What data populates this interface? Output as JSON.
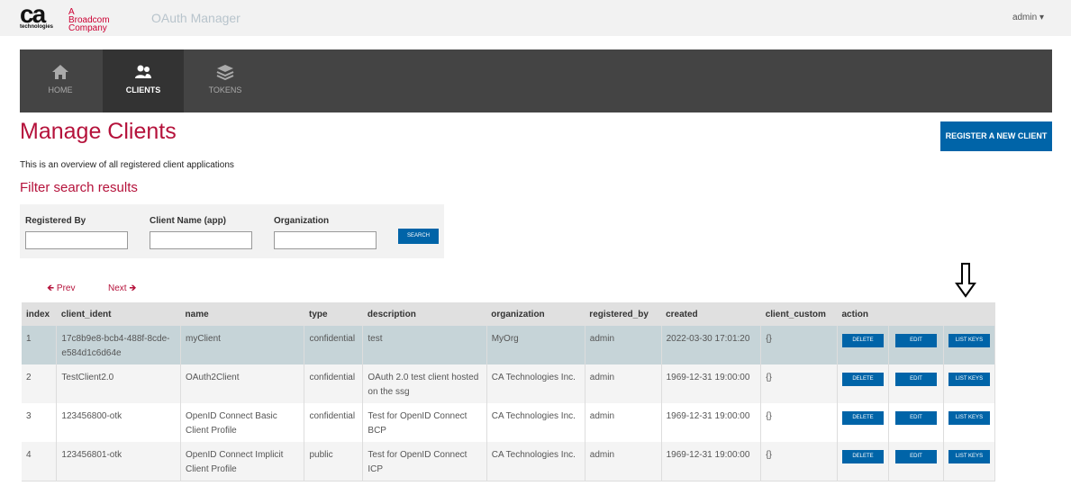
{
  "header": {
    "logo_text": "ca",
    "logo_sub": "technologies",
    "logo_tag": "A Broadcom Company",
    "app_title": "OAuth Manager",
    "user": "admin"
  },
  "nav": [
    {
      "label": "HOME",
      "icon": "home-icon"
    },
    {
      "label": "CLIENTS",
      "icon": "users-icon",
      "active": true
    },
    {
      "label": "TOKENS",
      "icon": "layers-icon"
    }
  ],
  "page": {
    "title": "Manage Clients",
    "register_label": "REGISTER A NEW CLIENT",
    "description": "This is an overview of all registered client applications",
    "filter_title": "Filter search results"
  },
  "filter": {
    "registered_by_label": "Registered By",
    "registered_by_value": "",
    "client_name_label": "Client Name (app)",
    "client_name_value": "",
    "organization_label": "Organization",
    "organization_value": "",
    "search_label": "SEARCH"
  },
  "pager": {
    "prev": "Prev",
    "next": "Next"
  },
  "table": {
    "headers": [
      "index",
      "client_ident",
      "name",
      "type",
      "description",
      "organization",
      "registered_by",
      "created",
      "client_custom",
      "action"
    ],
    "rows": [
      {
        "index": "1",
        "client_ident": "17c8b9e8-bcb4-488f-8cde-e584d1c6d64e",
        "name": "myClient",
        "type": "confidential",
        "description": "test",
        "organization": "MyOrg",
        "registered_by": "admin",
        "created": "2022-03-30 17:01:20",
        "client_custom": "{}"
      },
      {
        "index": "2",
        "client_ident": "TestClient2.0",
        "name": "OAuth2Client",
        "type": "confidential",
        "description": "OAuth 2.0 test client hosted on the ssg",
        "organization": "CA Technologies Inc.",
        "registered_by": "admin",
        "created": "1969-12-31 19:00:00",
        "client_custom": "{}"
      },
      {
        "index": "3",
        "client_ident": "123456800-otk",
        "name": "OpenID Connect Basic Client Profile",
        "type": "confidential",
        "description": "Test for OpenID Connect BCP",
        "organization": "CA Technologies Inc.",
        "registered_by": "admin",
        "created": "1969-12-31 19:00:00",
        "client_custom": "{}"
      },
      {
        "index": "4",
        "client_ident": "123456801-otk",
        "name": "OpenID Connect Implicit Client Profile",
        "type": "public",
        "description": "Test for OpenID Connect ICP",
        "organization": "CA Technologies Inc.",
        "registered_by": "admin",
        "created": "1969-12-31 19:00:00",
        "client_custom": "{}"
      }
    ],
    "actions": {
      "delete": "DELETE",
      "edit": "EDIT",
      "list_keys": "LIST KEYS"
    }
  },
  "colors": {
    "brand_red": "#b5123b",
    "button_blue": "#0064a8",
    "nav_bg": "#444444",
    "selected_row": "#c6d4d8"
  }
}
